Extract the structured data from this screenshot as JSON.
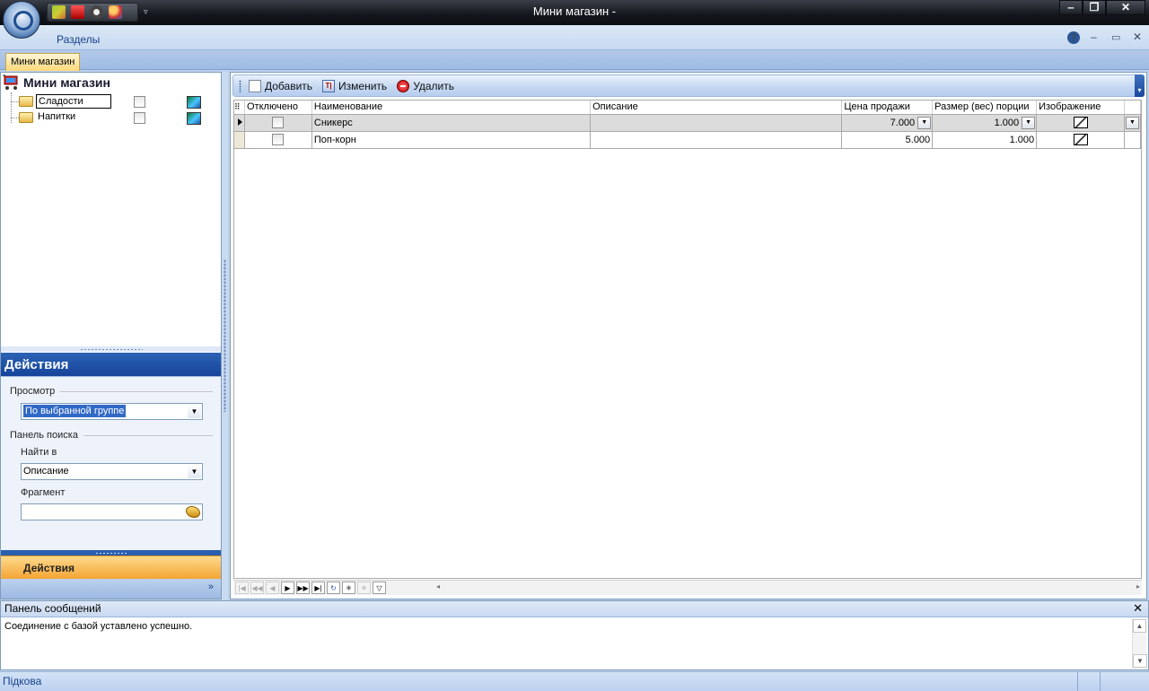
{
  "window": {
    "title": "Мини магазин -",
    "min_glyph": "‒",
    "max_glyph": "❐",
    "close_glyph": "✕"
  },
  "quick_access": {
    "more_glyph": "▿",
    "icons": [
      "grid-icon",
      "box-icon",
      "film-icon",
      "users-icon"
    ]
  },
  "ribbon": {
    "section_label": "Разделы",
    "help_glyph": "?",
    "min_glyph": "–",
    "restore_glyph": "▭",
    "close_glyph": "✕"
  },
  "document_tab": "Мини магазин",
  "tree": {
    "root_label": "Мини магазин",
    "items": [
      {
        "label": "Сладости",
        "selected": true
      },
      {
        "label": "Напитки",
        "selected": false
      }
    ]
  },
  "actions": {
    "header": "Действия",
    "view_group": "Просмотр",
    "view_value": "По выбранной группе",
    "search_group": "Панель поиска",
    "find_in_label": "Найти в",
    "find_in_value": "Описание",
    "fragment_label": "Фрагмент",
    "fragment_value": "",
    "nav_button": "Действия",
    "footer_glyph": "»",
    "dropdown_glyph": "▼"
  },
  "toolbar": {
    "add": "Добавить",
    "edit": "Изменить",
    "delete": "Удалить",
    "edit_icon_text": "T|",
    "end_glyph": "▾"
  },
  "grid": {
    "columns": [
      "Отключено",
      "Наименование",
      "Описание",
      "Цена продажи",
      "Размер (вес) порции",
      "Изображение"
    ],
    "rows": [
      {
        "disabled": false,
        "name": "Сникерс",
        "description": "",
        "price": "7.000",
        "portion": "1.000",
        "current": true
      },
      {
        "disabled": false,
        "name": "Поп-корн",
        "description": "",
        "price": "5.000",
        "portion": "1.000",
        "current": false
      }
    ],
    "cell_drop_glyph": "▼",
    "header_glyph": "⠿"
  },
  "navigator": {
    "buttons": [
      "|◀",
      "◀◀",
      "◀",
      "▶",
      "▶▶",
      "▶|",
      "↻",
      "✳",
      "✳",
      "▽"
    ],
    "scroll_left": "◂",
    "scroll_right": "▸"
  },
  "messages": {
    "header": "Панель сообщений",
    "close_glyph": "✕",
    "text": "Соединение с базой уставлено успешно.",
    "scroll_up": "▲",
    "scroll_down": "▼"
  },
  "status": {
    "text": "Підкова"
  },
  "colors": {
    "accent": "#16449b",
    "nav_button": "#f3a534",
    "selection": "#3169c6"
  }
}
